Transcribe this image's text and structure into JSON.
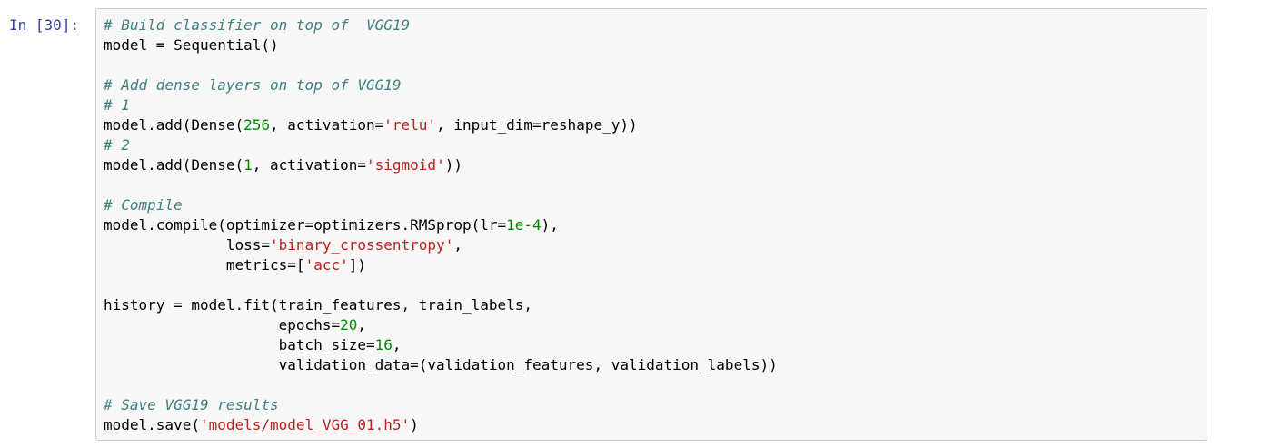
{
  "prompt": "In [30]:",
  "code_lines": [
    [
      {
        "t": "comment",
        "v": "# Build classifier on top of  VGG19"
      }
    ],
    [
      {
        "t": "plain",
        "v": "model = Sequential()"
      }
    ],
    [],
    [
      {
        "t": "comment",
        "v": "# Add dense layers on top of VGG19"
      }
    ],
    [
      {
        "t": "comment",
        "v": "# 1"
      }
    ],
    [
      {
        "t": "plain",
        "v": "model.add(Dense("
      },
      {
        "t": "number",
        "v": "256"
      },
      {
        "t": "plain",
        "v": ", activation="
      },
      {
        "t": "string",
        "v": "'relu'"
      },
      {
        "t": "plain",
        "v": ", input_dim=reshape_y))"
      }
    ],
    [
      {
        "t": "comment",
        "v": "# 2"
      }
    ],
    [
      {
        "t": "plain",
        "v": "model.add(Dense("
      },
      {
        "t": "number",
        "v": "1"
      },
      {
        "t": "plain",
        "v": ", activation="
      },
      {
        "t": "string",
        "v": "'sigmoid'"
      },
      {
        "t": "plain",
        "v": "))"
      }
    ],
    [],
    [
      {
        "t": "comment",
        "v": "# Compile"
      }
    ],
    [
      {
        "t": "plain",
        "v": "model.compile(optimizer=optimizers.RMSprop(lr="
      },
      {
        "t": "number",
        "v": "1e-4"
      },
      {
        "t": "plain",
        "v": "),"
      }
    ],
    [
      {
        "t": "plain",
        "v": "              loss="
      },
      {
        "t": "string",
        "v": "'binary_crossentropy'"
      },
      {
        "t": "plain",
        "v": ","
      }
    ],
    [
      {
        "t": "plain",
        "v": "              metrics=["
      },
      {
        "t": "string",
        "v": "'acc'"
      },
      {
        "t": "plain",
        "v": "])"
      }
    ],
    [],
    [
      {
        "t": "plain",
        "v": "history = model.fit(train_features, train_labels,"
      }
    ],
    [
      {
        "t": "plain",
        "v": "                    epochs="
      },
      {
        "t": "number",
        "v": "20"
      },
      {
        "t": "plain",
        "v": ","
      }
    ],
    [
      {
        "t": "plain",
        "v": "                    batch_size="
      },
      {
        "t": "number",
        "v": "16"
      },
      {
        "t": "plain",
        "v": ","
      }
    ],
    [
      {
        "t": "plain",
        "v": "                    validation_data=(validation_features, validation_labels))"
      }
    ],
    [],
    [
      {
        "t": "comment",
        "v": "# Save VGG19 results"
      }
    ],
    [
      {
        "t": "plain",
        "v": "model.save("
      },
      {
        "t": "string",
        "v": "'models/model_VGG_01.h5'"
      },
      {
        "t": "plain",
        "v": ")"
      }
    ]
  ]
}
